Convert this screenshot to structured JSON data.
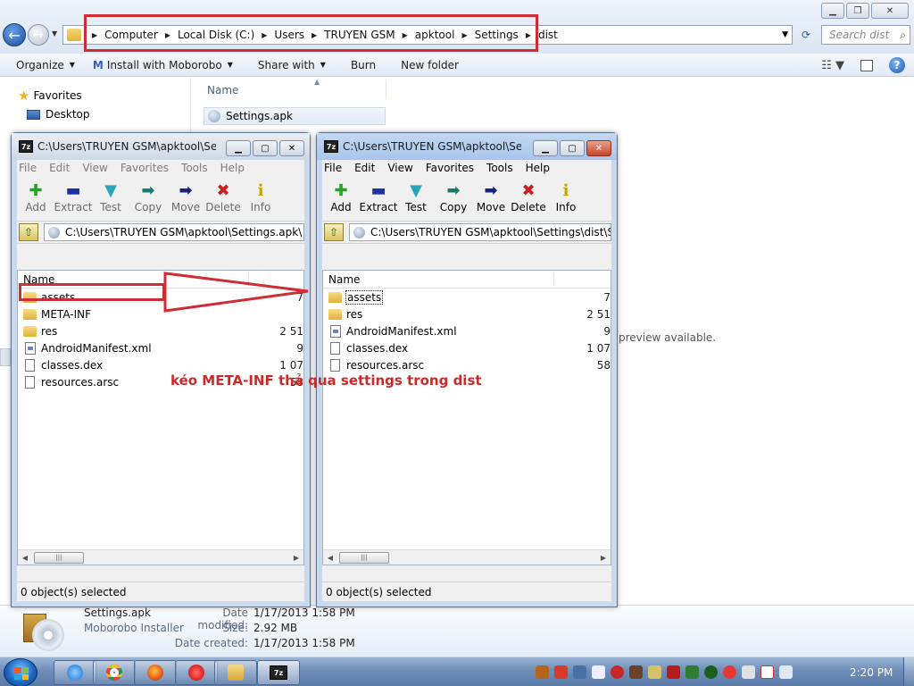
{
  "explorer": {
    "breadcrumbs": [
      "Computer",
      "Local Disk (C:)",
      "Users",
      "TRUYEN GSM",
      "apktool",
      "Settings",
      "dist"
    ],
    "search_placeholder": "Search dist",
    "toolbar": {
      "organize": "Organize",
      "install": "Install with Moborobo",
      "share": "Share with",
      "burn": "Burn",
      "new_folder": "New folder"
    },
    "nav": {
      "favorites": "Favorites",
      "desktop": "Desktop"
    },
    "column_name": "Name",
    "file": "Settings.apk",
    "preview_text": "preview available.",
    "details": {
      "name": "Settings.apk",
      "type": "Moborobo Installer",
      "modified_label": "Date modified:",
      "modified": "1/17/2013 1:58 PM",
      "size_label": "Size:",
      "size": "2.92 MB",
      "created_label": "Date created:",
      "created": "1/17/2013 1:58 PM"
    }
  },
  "zip_common": {
    "logo": "7z",
    "menu": [
      "File",
      "Edit",
      "View",
      "Favorites",
      "Tools",
      "Help"
    ],
    "tools": [
      {
        "label": "Add",
        "icon": "add-icon",
        "glyph": "✚",
        "color": "#1fa51f"
      },
      {
        "label": "Extract",
        "icon": "extract-icon",
        "glyph": "▬",
        "color": "#1e2fa8"
      },
      {
        "label": "Test",
        "icon": "test-icon",
        "glyph": "▼",
        "color": "#2aa5b5"
      },
      {
        "label": "Copy",
        "icon": "copy-icon",
        "glyph": "➡",
        "color": "#1d7a6e"
      },
      {
        "label": "Move",
        "icon": "move-icon",
        "glyph": "➡",
        "color": "#17237a"
      },
      {
        "label": "Delete",
        "icon": "delete-icon",
        "glyph": "✖",
        "color": "#d01c1c"
      },
      {
        "label": "Info",
        "icon": "info-icon",
        "glyph": "i",
        "color": "#c8a400"
      }
    ],
    "column_name": "Name",
    "status": "0 object(s) selected"
  },
  "zip_left": {
    "title": "C:\\Users\\TRUYEN GSM\\apktool\\Settings.apk\\",
    "path": "C:\\Users\\TRUYEN GSM\\apktool\\Settings.apk\\",
    "files": [
      {
        "name": "assets",
        "kind": "folder",
        "size": "7"
      },
      {
        "name": "META-INF",
        "kind": "folder",
        "size": ""
      },
      {
        "name": "res",
        "kind": "folder",
        "size": "2 51"
      },
      {
        "name": "AndroidManifest.xml",
        "kind": "xml",
        "size": "9"
      },
      {
        "name": "classes.dex",
        "kind": "file",
        "size": "1 07"
      },
      {
        "name": "resources.arsc",
        "kind": "file",
        "size": "58"
      }
    ]
  },
  "zip_right": {
    "title": "C:\\Users\\TRUYEN GSM\\apktool\\Settings\\dist\\Settings.apk\\",
    "path": "C:\\Users\\TRUYEN GSM\\apktool\\Settings\\dist\\S",
    "files": [
      {
        "name": "assets",
        "kind": "folder",
        "size": "7"
      },
      {
        "name": "res",
        "kind": "folder",
        "size": "2 51"
      },
      {
        "name": "AndroidManifest.xml",
        "kind": "xml",
        "size": "9"
      },
      {
        "name": "classes.dex",
        "kind": "file",
        "size": "1 07"
      },
      {
        "name": "resources.arsc",
        "kind": "file",
        "size": "58"
      }
    ]
  },
  "annotation": {
    "note": "kéo META-INF thả qua settings trong dist",
    "color": "#d02c36"
  },
  "taskbar": {
    "clock": "2:20 PM"
  }
}
